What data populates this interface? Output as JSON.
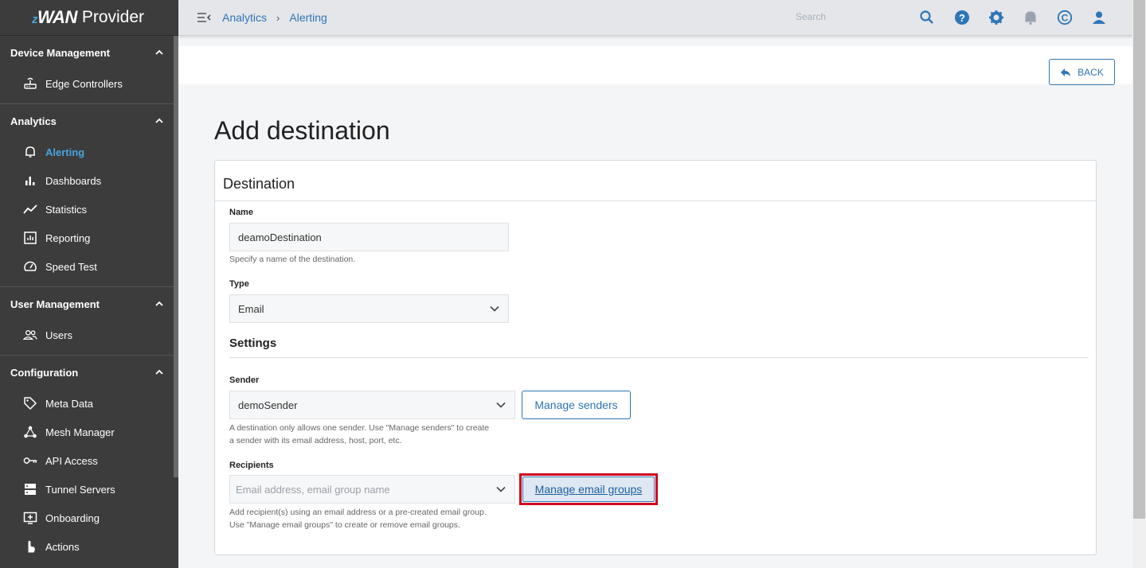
{
  "app": {
    "brand_z": "z",
    "brand_wan": "WAN",
    "brand_suffix": "Provider"
  },
  "sidebar": {
    "sections": [
      {
        "title": "Device Management",
        "items": [
          {
            "label": "Edge Controllers",
            "icon": "router-icon"
          }
        ]
      },
      {
        "title": "Analytics",
        "items": [
          {
            "label": "Alerting",
            "icon": "bell-icon",
            "active": true
          },
          {
            "label": "Dashboards",
            "icon": "bar-chart-icon"
          },
          {
            "label": "Statistics",
            "icon": "trend-icon"
          },
          {
            "label": "Reporting",
            "icon": "report-icon"
          },
          {
            "label": "Speed Test",
            "icon": "speedometer-icon"
          }
        ]
      },
      {
        "title": "User Management",
        "items": [
          {
            "label": "Users",
            "icon": "users-icon"
          }
        ]
      },
      {
        "title": "Configuration",
        "items": [
          {
            "label": "Meta Data",
            "icon": "tag-icon"
          },
          {
            "label": "Mesh Manager",
            "icon": "mesh-icon"
          },
          {
            "label": "API Access",
            "icon": "key-icon"
          },
          {
            "label": "Tunnel Servers",
            "icon": "server-icon"
          },
          {
            "label": "Onboarding",
            "icon": "onboarding-icon"
          },
          {
            "label": "Actions",
            "icon": "hand-icon"
          }
        ]
      }
    ]
  },
  "topbar": {
    "breadcrumb": [
      "Analytics",
      "Alerting"
    ],
    "search_placeholder": "Search",
    "icons": [
      "search-icon",
      "help-icon",
      "gear-icon",
      "bell-icon",
      "copyright-icon",
      "user-icon"
    ]
  },
  "page": {
    "back_label": "BACK",
    "title": "Add destination",
    "card_title": "Destination"
  },
  "form": {
    "name_label": "Name",
    "name_value": "deamoDestination",
    "name_help": "Specify a name of the destination.",
    "type_label": "Type",
    "type_value": "Email",
    "settings_title": "Settings",
    "sender_label": "Sender",
    "sender_value": "demoSender",
    "manage_senders_label": "Manage senders",
    "sender_help_1": "A destination only allows one sender. Use \"Manage senders\" to create",
    "sender_help_2": "a sender with its email address, host, port, etc.",
    "recipients_label": "Recipients",
    "recipients_placeholder": "Email address, email group name",
    "manage_groups_label": "Manage email groups",
    "recipients_help_1": "Add recipient(s) using an email address or a pre-created email group.",
    "recipients_help_2": "Use \"Manage email groups\" to create or remove email groups."
  },
  "colors": {
    "accent": "#2e75b6",
    "highlight": "#d0021b",
    "sidebar_bg": "#3c3c3c",
    "active_item": "#4aa3df"
  }
}
